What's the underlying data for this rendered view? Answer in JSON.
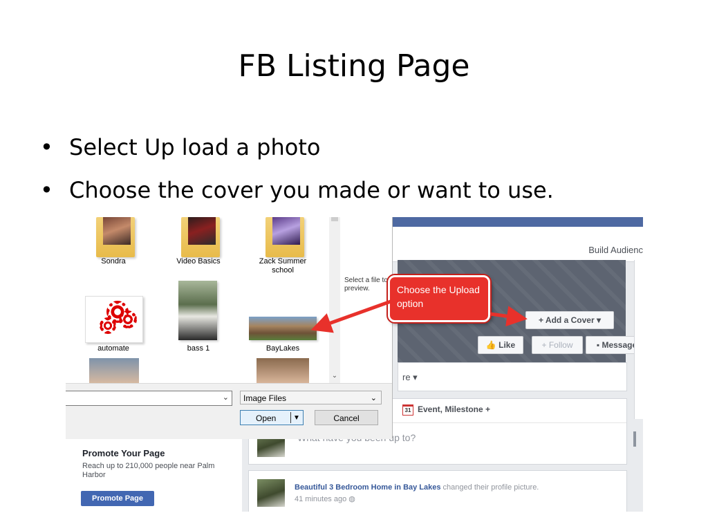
{
  "slide": {
    "title": "FB Listing Page",
    "bullets": [
      "Select Up load a photo",
      "Choose the cover you made or want to use."
    ]
  },
  "dialog": {
    "files": [
      {
        "label": "Sondra"
      },
      {
        "label": "Video Basics"
      },
      {
        "label": "Zack Summer school"
      },
      {
        "label": "automate"
      },
      {
        "label": "bass 1"
      },
      {
        "label": "BayLakes"
      }
    ],
    "preview_text": "Select a file to preview.",
    "file_name_value": "",
    "file_type": "Image Files",
    "open_label": "Open",
    "cancel_label": "Cancel"
  },
  "callout": {
    "text": "Choose the Upload option"
  },
  "facebook": {
    "build_audience": "Build Audienc",
    "add_cover": "+ Add a Cover ▾",
    "like": "Like",
    "follow": "+ Follow",
    "message": "Message",
    "more_dots": "•••",
    "more_label": "re ▾",
    "event_milestone": "Event, Milestone +",
    "calendar_day": "31",
    "composer_placeholder": "What have you been up to?",
    "post": {
      "page_name": "Beautiful 3 Bedroom Home in Bay Lakes",
      "action": " changed their profile picture.",
      "time": "41 minutes ago"
    },
    "promote": {
      "title": "Promote Your Page",
      "reach": "Reach up to 210,000 people near Palm Harbor",
      "button": "Promote Page"
    }
  },
  "colors": {
    "fb_blue": "#4e69a2",
    "callout_red": "#e8312b",
    "promote_button": "#4267b2"
  }
}
